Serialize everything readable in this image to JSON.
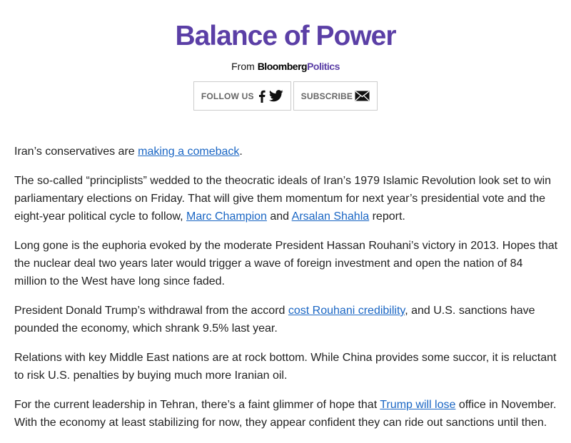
{
  "header": {
    "title": "Balance of Power",
    "from_prefix": "From",
    "brand_name": "Bloomberg",
    "brand_accent": "Politics",
    "brand_color": "#5b3fa6"
  },
  "buttons": {
    "follow_label": "FOLLOW US",
    "facebook_icon": "facebook-icon",
    "twitter_icon": "twitter-icon",
    "subscribe_label": "SUBSCRIBE",
    "mail_icon": "mail-icon"
  },
  "article": {
    "p1": {
      "before": "Iran’s conservatives are ",
      "link": "making a comeback",
      "after": "."
    },
    "p2": {
      "before": "The so-called “principlists” wedded to the theocratic ideals of Iran’s 1979 Islamic Revolution look set to win parliamentary elections on Friday. That will give them momentum for next year’s presidential vote and the eight-year political cycle to follow, ",
      "link1": "Marc Champion",
      "middle": " and ",
      "link2": "Arsalan Shahla",
      "after": " report."
    },
    "p3": {
      "text": "Long gone is the euphoria evoked by the moderate President Hassan Rouhani’s victory in 2013. Hopes that the nuclear deal two years later would trigger a wave of foreign investment and open the nation of 84 million to the West have long since faded."
    },
    "p4": {
      "before": "President Donald Trump’s withdrawal from the accord ",
      "link": "cost Rouhani credibility",
      "after": ", and U.S. sanctions have pounded the economy, which shrank 9.5% last year."
    },
    "p5": {
      "text": "Relations with key Middle East nations are at rock bottom. While China provides some succor, it is reluctant to risk U.S. penalties by buying much more Iranian oil."
    },
    "p6": {
      "before": "For the current leadership in Tehran, there’s a faint glimmer of hope that ",
      "link": "Trump will lose",
      "after": " office in November. With the economy at least stabilizing for now, they appear confident they can ride out sanctions until then."
    },
    "link_color": "#1a66c4"
  }
}
